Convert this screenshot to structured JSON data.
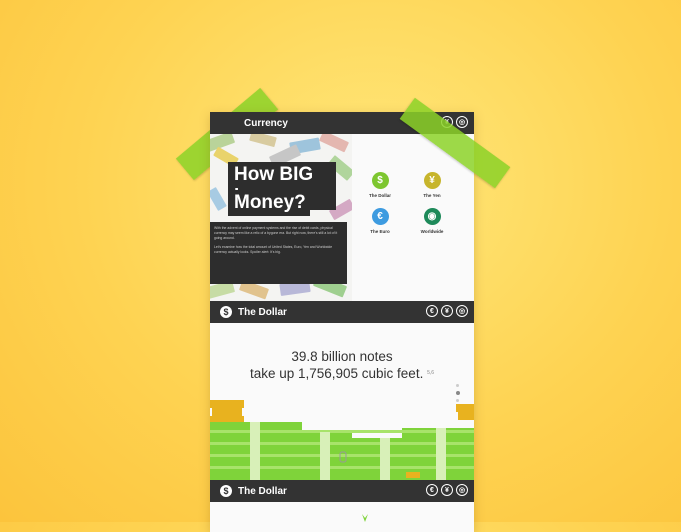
{
  "header": {
    "title": "Currency"
  },
  "hero": {
    "title_line1": "How BIG is",
    "title_line2": "Money?",
    "paragraph1": "With the advent of online payment systems and the rise of debit cards, physical currency may seem like a relic of a bygone era. But right now, there's still a lot of it going around.",
    "paragraph2": "Let's examine how the total amount of United States, Euro, Yen and Worldwide currency actually looks. Spoiler alert: It's big."
  },
  "currencies": [
    {
      "label": "The Dollar",
      "symbol": "$",
      "color": "#7dc62f"
    },
    {
      "label": "The Yen",
      "symbol": "¥",
      "color": "#c7b52c"
    },
    {
      "label": "The Euro",
      "symbol": "€",
      "color": "#3d9be0"
    },
    {
      "label": "Worldwide",
      "symbol": "◉",
      "color": "#1e8a5a"
    }
  ],
  "section1": {
    "title": "The Dollar",
    "badge": "$"
  },
  "section2": {
    "title": "The Dollar",
    "badge": "$"
  },
  "nav_icons": [
    "€",
    "¥",
    "◎"
  ],
  "stats": {
    "line1": "39.8 billion notes",
    "line2": "take up 1,756,905 cubic feet.",
    "footnote": "5,6"
  }
}
